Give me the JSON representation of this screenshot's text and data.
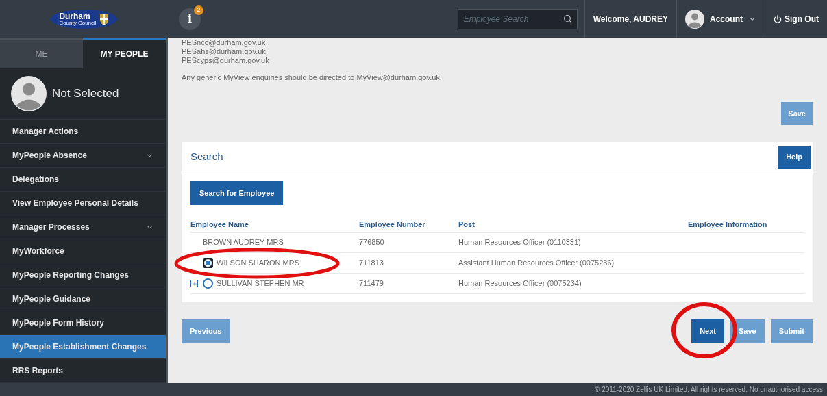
{
  "header": {
    "logo": {
      "name": "Durham",
      "subtitle": "County Council"
    },
    "notifications": {
      "count": "2",
      "icon_text": "i"
    },
    "search": {
      "placeholder": "Employee Search"
    },
    "welcome": "Welcome, AUDREY",
    "account": "Account",
    "sign_out": "Sign Out"
  },
  "sidebar": {
    "tabs": [
      {
        "label": "ME",
        "selected": false
      },
      {
        "label": "MY PEOPLE",
        "selected": true
      }
    ],
    "person": "Not Selected",
    "items": [
      {
        "label": "Manager Actions",
        "expandable": false,
        "selected": false
      },
      {
        "label": "MyPeople Absence",
        "expandable": true,
        "selected": false
      },
      {
        "label": "Delegations",
        "expandable": false,
        "selected": false
      },
      {
        "label": "View Employee Personal Details",
        "expandable": false,
        "selected": false
      },
      {
        "label": "Manager Processes",
        "expandable": true,
        "selected": false
      },
      {
        "label": "MyWorkforce",
        "expandable": false,
        "selected": false
      },
      {
        "label": "MyPeople Reporting Changes",
        "expandable": false,
        "selected": false
      },
      {
        "label": "MyPeople Guidance",
        "expandable": false,
        "selected": false
      },
      {
        "label": "MyPeople Form History",
        "expandable": false,
        "selected": false
      },
      {
        "label": "MyPeople Establishment Changes",
        "expandable": false,
        "selected": true
      },
      {
        "label": "RRS Reports",
        "expandable": false,
        "selected": false
      }
    ]
  },
  "info": {
    "emails": [
      "PESncc@durham.gov.uk",
      "PESahs@durham.gov.uk",
      "PEScyps@durham.gov.uk"
    ],
    "note": "Any generic MyView enquiries should be directed to MyView@durham.gov.uk.",
    "save": "Save"
  },
  "search_panel": {
    "title": "Search",
    "help": "Help",
    "search_button": "Search for Employee",
    "columns": [
      "Employee Name",
      "Employee Number",
      "Post",
      "Employee Information"
    ],
    "rows": [
      {
        "kind": "plain",
        "expandable": false,
        "name": "BROWN AUDREY MRS",
        "number": "776850",
        "post": "Human Resources Officer (0110331)"
      },
      {
        "kind": "radio",
        "expandable": false,
        "selected": true,
        "name": "WILSON SHARON MRS",
        "number": "711813",
        "post": "Assistant Human Resources Officer (0075236)"
      },
      {
        "kind": "radio",
        "expandable": true,
        "selected": false,
        "name": "SULLIVAN STEPHEN MR",
        "number": "711479",
        "post": "Human Resources Officer (0075234)"
      }
    ]
  },
  "actions": {
    "previous": "Previous",
    "next": "Next",
    "save": "Save",
    "submit": "Submit"
  },
  "footer": "© 2011-2020 Zellis UK Limited. All rights reserved. No unauthorised access"
}
